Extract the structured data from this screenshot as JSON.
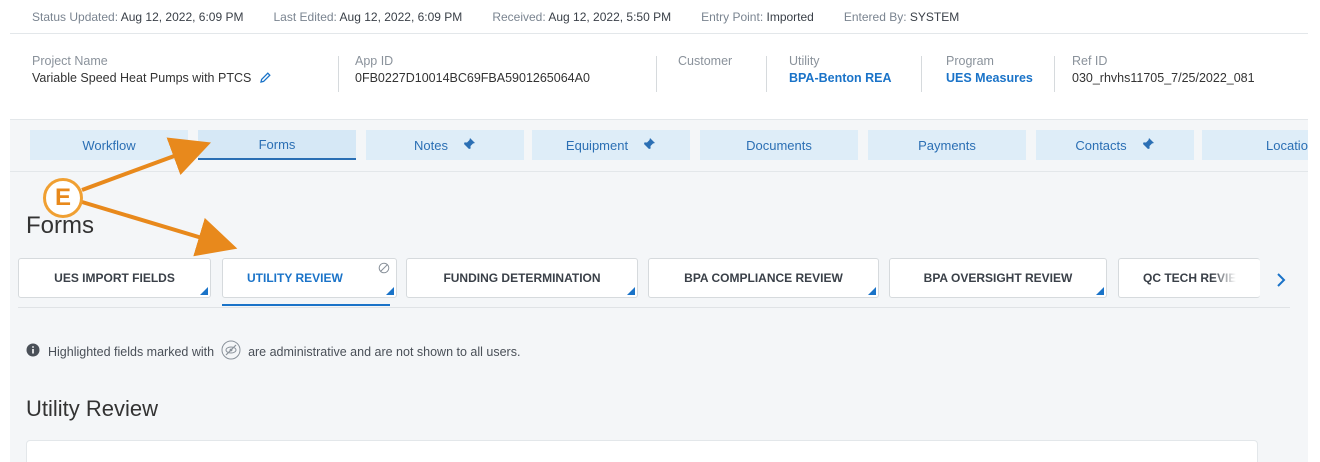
{
  "status": {
    "status_updated_label": "Status Updated:",
    "status_updated_value": "Aug 12, 2022, 6:09 PM",
    "last_edited_label": "Last Edited:",
    "last_edited_value": "Aug 12, 2022, 6:09 PM",
    "received_label": "Received:",
    "received_value": "Aug 12, 2022, 5:50 PM",
    "entry_point_label": "Entry Point:",
    "entry_point_value": "Imported",
    "entered_by_label": "Entered By:",
    "entered_by_value": "SYSTEM"
  },
  "header": {
    "project_name_label": "Project Name",
    "project_name_value": "Variable Speed Heat Pumps with PTCS",
    "app_id_label": "App ID",
    "app_id_value": "0FB0227D10014BC69FBA5901265064A0",
    "customer_label": "Customer",
    "utility_label": "Utility",
    "utility_value": "BPA-Benton REA",
    "program_label": "Program",
    "program_value": "UES Measures",
    "ref_id_label": "Ref ID",
    "ref_id_value": "030_rhvhs11705_7/25/2022_081"
  },
  "tabs": [
    {
      "label": "Workflow"
    },
    {
      "label": "Forms"
    },
    {
      "label": "Notes"
    },
    {
      "label": "Equipment"
    },
    {
      "label": "Documents"
    },
    {
      "label": "Payments"
    },
    {
      "label": "Contacts"
    },
    {
      "label": "Location"
    }
  ],
  "forms": {
    "title": "Forms",
    "tabs": [
      {
        "label": "UES IMPORT FIELDS"
      },
      {
        "label": "UTILITY REVIEW"
      },
      {
        "label": "FUNDING DETERMINATION"
      },
      {
        "label": "BPA COMPLIANCE REVIEW"
      },
      {
        "label": "BPA OVERSIGHT REVIEW"
      },
      {
        "label": "QC TECH REVIE"
      }
    ],
    "notice_part1": "Highlighted fields marked with",
    "notice_part2": "are administrative and are not shown to all users.",
    "section_title": "Utility Review"
  },
  "annotation": {
    "badge_letter": "E",
    "color": "#e8891c"
  },
  "colors": {
    "accent": "#1a73c8",
    "tab_bg": "#deedf8",
    "annotation": "#e8891c"
  },
  "icons": [
    "pencil-icon",
    "pin-icon",
    "no-admin-icon",
    "info-icon",
    "eye-slash-icon",
    "chevron-right-icon"
  ]
}
